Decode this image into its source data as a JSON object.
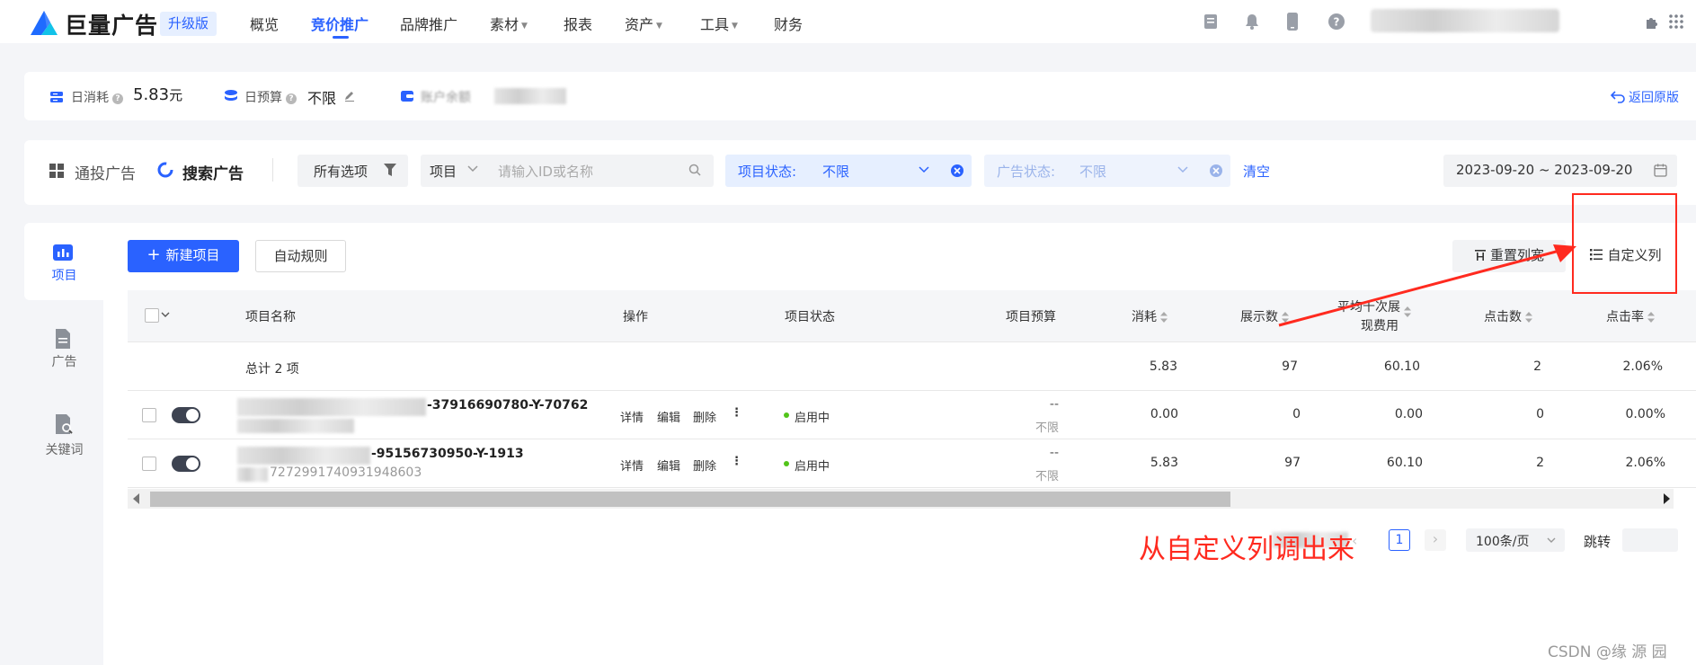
{
  "topnav": {
    "logo_text": "巨量广告",
    "upgrade_badge": "升级版",
    "items": [
      {
        "label": "概览"
      },
      {
        "label": "竞价推广"
      },
      {
        "label": "品牌推广"
      },
      {
        "label": "素材"
      },
      {
        "label": "报表"
      },
      {
        "label": "资产"
      },
      {
        "label": "工具"
      },
      {
        "label": "财务"
      }
    ]
  },
  "stats": {
    "daily_spend_label": "日消耗",
    "daily_spend_value": "5.83",
    "daily_spend_unit": "元",
    "daily_budget_label": "日预算",
    "daily_budget_value": "不限",
    "account_balance_label": "账户余额",
    "return_old_version": "返回原版"
  },
  "filters": {
    "tab_general": "通投广告",
    "tab_search": "搜索广告",
    "all_options": "所有选项",
    "search_scope": "项目",
    "search_placeholder": "请输入ID或名称",
    "project_status_label": "项目状态:",
    "project_status_value": "不限",
    "ad_status_label": "广告状态:",
    "ad_status_value": "不限",
    "clear": "清空",
    "date_range": "2023-09-20 ~ 2023-09-20"
  },
  "sidebar": {
    "items": [
      {
        "label": "项目"
      },
      {
        "label": "广告"
      },
      {
        "label": "关键词"
      }
    ]
  },
  "toolbar": {
    "new_project": "新建项目",
    "auto_rules": "自动规则",
    "reset_columns": "重置列宽",
    "custom_columns": "自定义列"
  },
  "table": {
    "headers": {
      "name": "项目名称",
      "actions": "操作",
      "status": "项目状态",
      "budget": "项目预算",
      "spend": "消耗",
      "impressions": "展示数",
      "avg_cpm_line1": "平均千次展",
      "avg_cpm_line2": "现费用",
      "clicks": "点击数",
      "ctr": "点击率"
    },
    "total": {
      "label": "总计 2 项",
      "spend": "5.83",
      "impressions": "97",
      "avg_cpm": "60.10",
      "clicks": "2",
      "ctr": "2.06%"
    },
    "rows": [
      {
        "name": "-37916690780-Y-70762",
        "id": "",
        "actions": [
          "详情",
          "编辑",
          "删除"
        ],
        "status": "启用中",
        "budget_dash": "--",
        "budget": "不限",
        "spend": "0.00",
        "impressions": "0",
        "avg_cpm": "0.00",
        "clicks": "0",
        "ctr": "0.00%"
      },
      {
        "name": "-95156730950-Y-1913",
        "id": "7272991740931948603",
        "actions": [
          "详情",
          "编辑",
          "删除"
        ],
        "status": "启用中",
        "budget_dash": "--",
        "budget": "不限",
        "spend": "5.83",
        "impressions": "97",
        "avg_cpm": "60.10",
        "clicks": "2",
        "ctr": "2.06%"
      }
    ]
  },
  "pagination": {
    "current_page": "1",
    "page_size": "100条/页",
    "jump_label": "跳转"
  },
  "annotation": {
    "text": "从自定义列调出来"
  },
  "watermark": "CSDN @缘 源 园",
  "colors": {
    "primary": "#2a62ff",
    "annotation_red": "#ff2a1f",
    "status_green": "#52c41a"
  }
}
